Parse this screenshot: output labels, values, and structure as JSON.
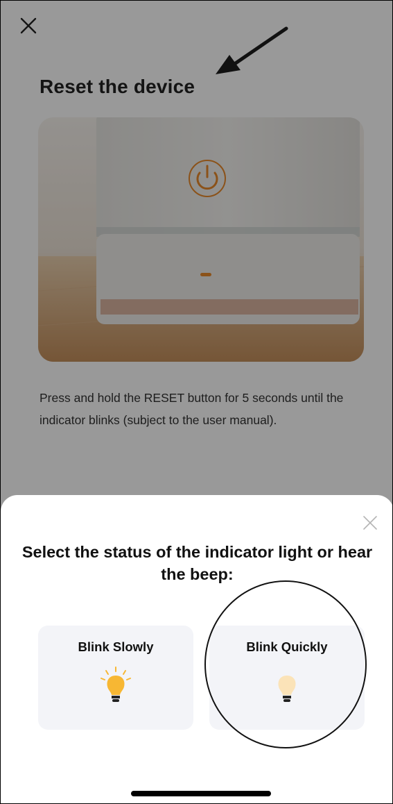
{
  "page": {
    "title": "Reset the device",
    "description": "Press and hold the RESET button for 5 seconds until the indicator blinks (subject to the user manual).",
    "icons": {
      "close": "close-icon",
      "power": "power-icon"
    }
  },
  "sheet": {
    "title": "Select the status of the indicator light or hear the beep:",
    "options": [
      {
        "label": "Blink Slowly",
        "icon": "bulb-lit-icon"
      },
      {
        "label": "Blink Quickly",
        "icon": "bulb-dim-icon"
      }
    ],
    "icons": {
      "close": "close-icon"
    }
  },
  "colors": {
    "bulb_bright": "#f7b733",
    "bulb_pale": "#fbe3b8",
    "indicator_orange": "#e8892b",
    "overlay": "rgba(0,0,0,0.40)"
  }
}
